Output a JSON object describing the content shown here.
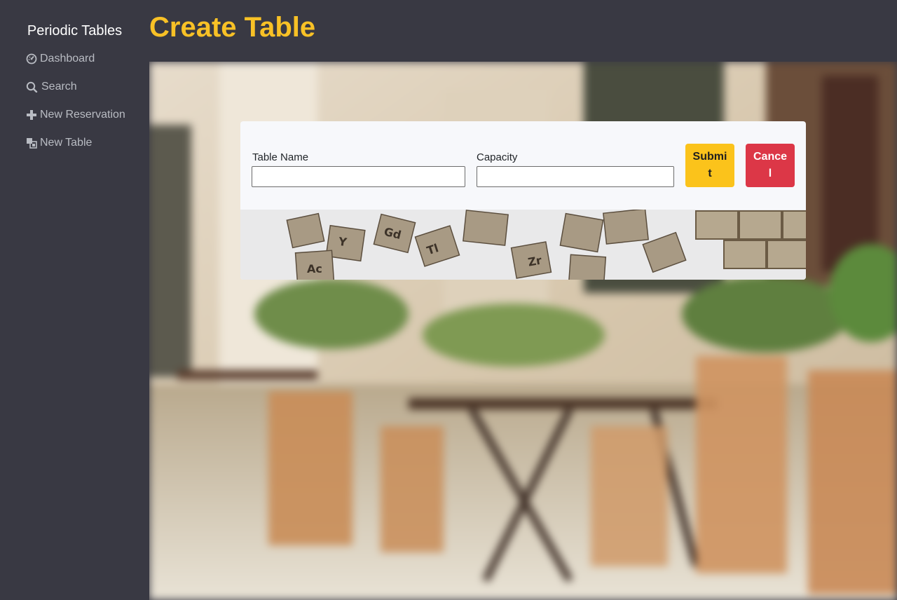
{
  "sidebar": {
    "brand": "Periodic Tables",
    "items": [
      {
        "label": "Dashboard",
        "icon": "dashboard-icon"
      },
      {
        "label": "Search",
        "icon": "search-icon"
      },
      {
        "label": "New Reservation",
        "icon": "plus-icon"
      },
      {
        "label": "New Table",
        "icon": "table-icon"
      }
    ]
  },
  "header": {
    "title": "Create Table"
  },
  "form": {
    "table_name_label": "Table Name",
    "table_name_value": "",
    "capacity_label": "Capacity",
    "capacity_value": "",
    "submit_label": "Submit",
    "cancel_label": "Cancel"
  },
  "colors": {
    "sidebar_bg": "#393943",
    "title": "#f8c126",
    "submit": "#fbc31b",
    "cancel": "#dc3747",
    "card_bg": "#f7f8fb"
  }
}
